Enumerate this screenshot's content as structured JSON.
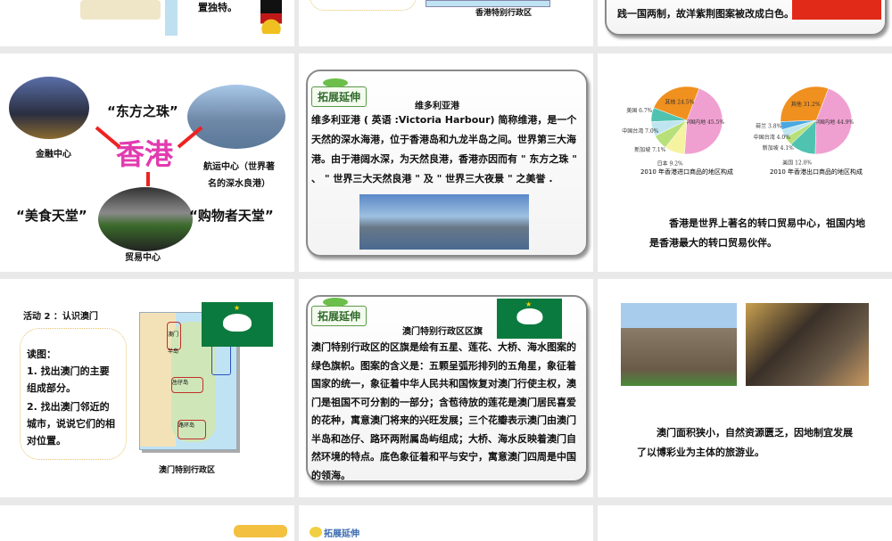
{
  "slides": {
    "s1": {
      "text": "置独特。"
    },
    "s2": {
      "caption": "香港特别行政区"
    },
    "s3": {
      "text": "践一国两制，故洋紫荆图案被改成白色。"
    },
    "s4": {
      "title": "香港",
      "nickname": "“东方之珠”",
      "finance": "金融中心",
      "shipping": "航运中心（世界著名的深水良港）",
      "trade": "贸易中心",
      "food": "“美食天堂”",
      "shopping": "“购物者天堂”"
    },
    "s5": {
      "tag": "拓展延伸",
      "title": "维多利亚港",
      "body": "维多利亚港 ( 英语 :Victoria Harbour) 简称维港，是一个天然的深水海港，位于香港岛和九龙半岛之间。世界第三大海港。由于港阔水深，为天然良港，香港亦因而有 \" 东方之珠 \" 、 \" 世界三大天然良港 \" 及 \" 世界三大夜景 \" 之美誉 ."
    },
    "s6": {
      "text": "香港是世界上著名的转口贸易中心，祖国内地是香港最大的转口贸易伙伴。"
    },
    "s7": {
      "title": "活动 2 ：认识澳门",
      "read": "读图：",
      "q1": "1. 找出澳门的主要组成部分。",
      "q2": "2. 找出澳门邻近的城市，说说它们的相对位置。",
      "caption": "澳门特别行政区",
      "map_labels": [
        "澳门半岛",
        "氹仔岛",
        "路环岛"
      ]
    },
    "s8": {
      "tag": "拓展延伸",
      "title": "澳门特别行政区区旗",
      "body": "澳门特别行政区的区旗是绘有五星、莲花、大桥、海水图案的绿色旗帜。图案的含义是：五颗呈弧形排列的五角星，象征着国家的统一，象征着中华人民共和国恢复对澳门行使主权，澳门是祖国不可分割的一部分；含苞待放的莲花是澳门居民喜爱的花种，寓意澳门将来的兴旺发展；三个花瓣表示澳门由澳门半岛和氹仔、路环两附属岛屿组成；大桥、海水反映着澳门自然环境的特点。底色象征着和平与安宁，寓意澳门四周是中国的领海。"
    },
    "s9": {
      "text": "澳门面积狭小，自然资源匮乏，因地制宜发展了以博彩业为主体的旅游业。"
    },
    "s11": {
      "tag": "拓展延伸"
    }
  },
  "chart_data": [
    {
      "type": "pie",
      "title": "2010 年香港进口商品的地区构成",
      "categories": [
        "中国内地",
        "日本",
        "新加坡",
        "中国台湾",
        "美国",
        "其他"
      ],
      "values": [
        45.5,
        9.2,
        7.1,
        7.0,
        6.7,
        24.5
      ],
      "colors": [
        "#f0a0d0",
        "#f6f3a0",
        "#b8e07a",
        "#bfe6f0",
        "#4fc3b0",
        "#f0901e"
      ]
    },
    {
      "type": "pie",
      "title": "2010 年香港出口商品的地区构成",
      "categories": [
        "中国内地",
        "美国",
        "新加坡",
        "中国台湾",
        "荷兰",
        "其他"
      ],
      "values": [
        44.9,
        12.0,
        4.1,
        4.0,
        3.8,
        31.2
      ],
      "colors": [
        "#f0a0d0",
        "#4fc3b0",
        "#b8e07a",
        "#bfe6f0",
        "#4aa8e0",
        "#f0901e"
      ]
    }
  ]
}
